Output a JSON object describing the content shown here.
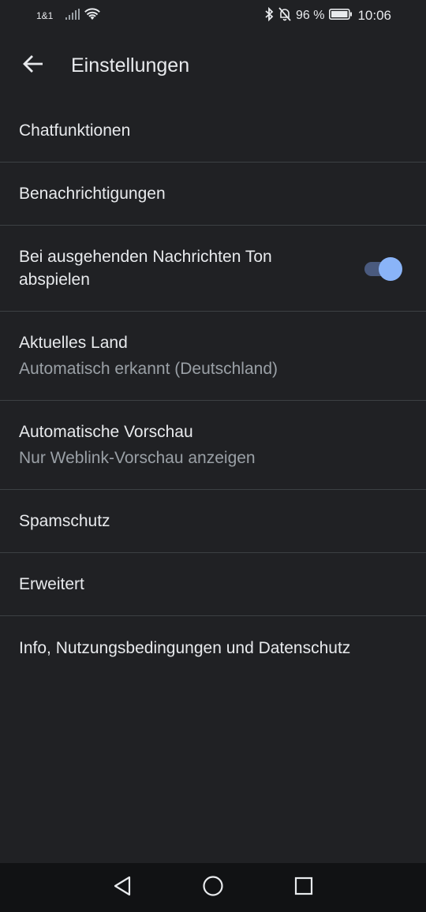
{
  "status_bar": {
    "carrier": "1&1",
    "battery_percent": "96 %",
    "time": "10:06",
    "icons": [
      "signal-icon",
      "wifi-icon",
      "bluetooth-icon",
      "bell-off-icon",
      "battery-icon"
    ]
  },
  "app_bar": {
    "title": "Einstellungen",
    "back_icon": "arrow-left-icon"
  },
  "settings": {
    "chat_features": {
      "title": "Chatfunktionen"
    },
    "notifications": {
      "title": "Benachrichtigungen"
    },
    "outgoing_sound": {
      "title": "Bei ausgehenden Nachrichten Ton abspielen",
      "enabled": true
    },
    "current_country": {
      "title": "Aktuelles Land",
      "subtitle": "Automatisch erkannt (Deutschland)"
    },
    "auto_preview": {
      "title": "Automatische Vorschau",
      "subtitle": "Nur Weblink-Vorschau anzeigen"
    },
    "spam_protection": {
      "title": "Spamschutz"
    },
    "advanced": {
      "title": "Erweitert"
    },
    "about": {
      "title": "Info, Nutzungsbedingungen und Datenschutz"
    }
  },
  "nav_bar": {
    "icons": [
      "back-triangle-icon",
      "home-circle-icon",
      "recents-square-icon"
    ]
  },
  "colors": {
    "background": "#202124",
    "text_primary": "#e8eaed",
    "text_secondary": "#9aa0a6",
    "divider": "#3c4043",
    "accent": "#8ab4f8",
    "nav_bar": "#111214"
  }
}
